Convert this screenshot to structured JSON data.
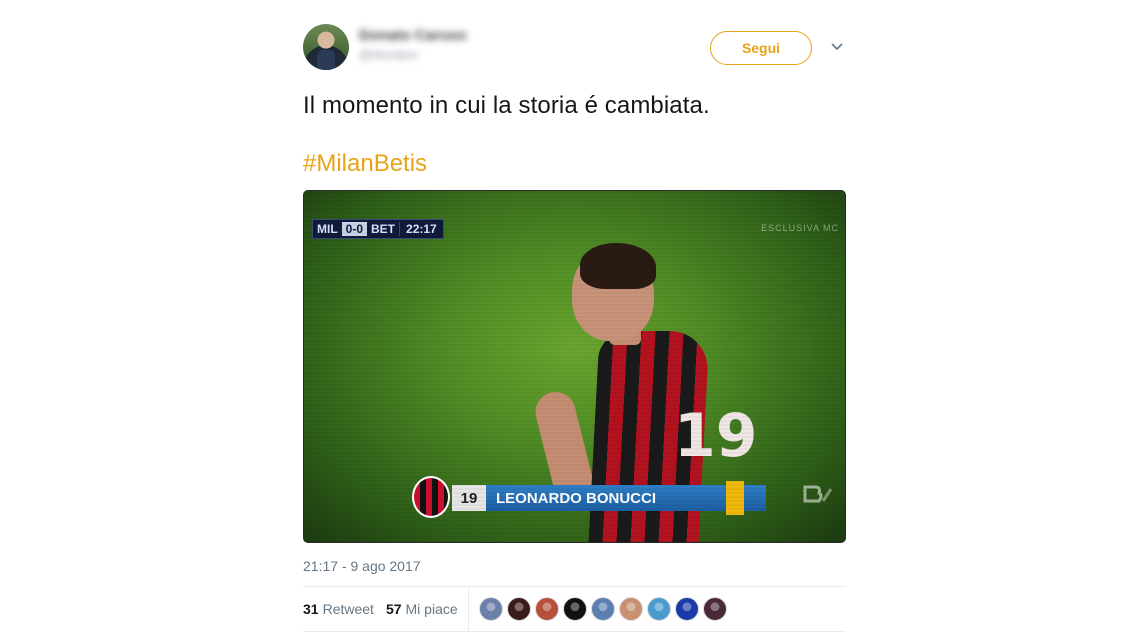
{
  "user": {
    "display_name": "Donato Caruso",
    "username": "@donatoc"
  },
  "follow_label": "Segui",
  "tweet": {
    "text": "Il momento in cui la storia é cambiata.",
    "hashtag": "#MilanBetis",
    "timestamp": "21:17 - 9 ago 2017"
  },
  "media": {
    "scorebug": {
      "home": "MIL",
      "score": "0-0",
      "away": "BET",
      "time": "22:17"
    },
    "broadcast": "ESCLUSIVA MC",
    "player_number": "19",
    "player_name": "LEONARDO BONUCCI",
    "shirt_number": "19"
  },
  "stats": {
    "retweets_count": "31",
    "retweets_label": "Retweet",
    "likes_count": "57",
    "likes_label": "Mi piace"
  },
  "likers": [
    {
      "color": "#6b7fa8"
    },
    {
      "color": "#3a1a1a"
    },
    {
      "color": "#b6503a"
    },
    {
      "color": "#111111"
    },
    {
      "color": "#5a7fb0"
    },
    {
      "color": "#c89070"
    },
    {
      "color": "#4a9ad0"
    },
    {
      "color": "#1a3aa8"
    },
    {
      "color": "#4a2a3a"
    }
  ],
  "colors": {
    "accent": "#e8a317",
    "text": "#14171a",
    "muted": "#657786"
  }
}
